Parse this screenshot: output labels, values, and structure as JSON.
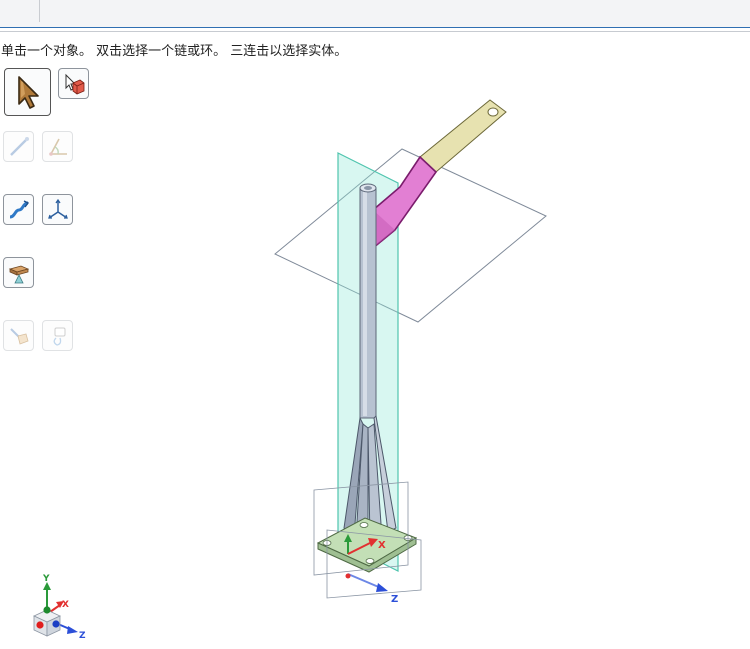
{
  "status": {
    "hint": "单击一个对象。 双击选择一个链或环。 三连击以选择实体。"
  },
  "toolbar": {
    "tools": [
      {
        "name": "select-arrow",
        "icon": "arrow-cursor-icon",
        "state": "active"
      },
      {
        "name": "select-body",
        "icon": "select-body-icon",
        "state": "enabled"
      },
      {
        "name": "line",
        "icon": "line-icon",
        "state": "disabled"
      },
      {
        "name": "angle",
        "icon": "angle-icon",
        "state": "disabled"
      },
      {
        "name": "curve",
        "icon": "curve-icon",
        "state": "enabled"
      },
      {
        "name": "axis",
        "icon": "axis-icon",
        "state": "enabled"
      },
      {
        "name": "block-move",
        "icon": "block-move-icon",
        "state": "enabled"
      },
      {
        "name": "pull",
        "icon": "pull-icon",
        "state": "disabled"
      },
      {
        "name": "fill",
        "icon": "fill-icon",
        "state": "disabled"
      }
    ]
  },
  "model_axes": {
    "x": "X",
    "z": "Z"
  },
  "view_triad": {
    "x": "X",
    "y": "Y",
    "z": "Z"
  },
  "colors": {
    "plane_fill": "#7fe6d2",
    "selected_face": "#e27fd3",
    "arm": "#e7e2b0",
    "post": "#b7c2d1",
    "base": "#c3dfb6",
    "axis_x": "#e23030",
    "axis_y": "#2a9a3a",
    "axis_z": "#2c4fd8"
  }
}
